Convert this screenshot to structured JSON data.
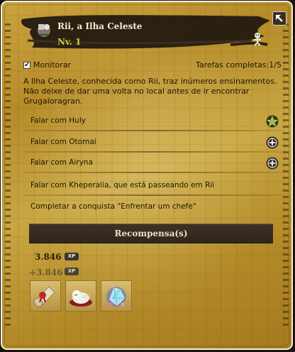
{
  "quest": {
    "title": "Rii, a Ilha Celeste",
    "level": "Nv. 1",
    "track_label": "Monitorar",
    "track_checked": true,
    "tasks_done": "Tarefas completas:1/5",
    "description": "A Ilha Celeste, conhecida como Rii, traz inúmeros ensinamentos. Não deixe de dar uma volta no local antes de ir encontrar Grugaloragran."
  },
  "tasks": [
    {
      "label": "Falar com Huly",
      "icon": "star-icon"
    },
    {
      "label": "Falar com Otomai",
      "icon": "compass-icon"
    },
    {
      "label": "Falar com Airyna",
      "icon": "compass-icon"
    },
    {
      "label": "Falar com Kheperalia, que está passeando em Rii",
      "icon": ""
    },
    {
      "label": "Completar a conquista \"Enfrentar um chefe\"",
      "icon": ""
    }
  ],
  "rewards": {
    "header": "Recompensa(s)",
    "xp": "3.846",
    "xp_bonus": "+3.846",
    "xp_badge": "XP",
    "items": [
      "scroll-icon",
      "sleeping-pet-icon",
      "crystal-icon"
    ]
  },
  "colors": {
    "accent_level": "#d8c63f",
    "star": "#8ec53a"
  }
}
